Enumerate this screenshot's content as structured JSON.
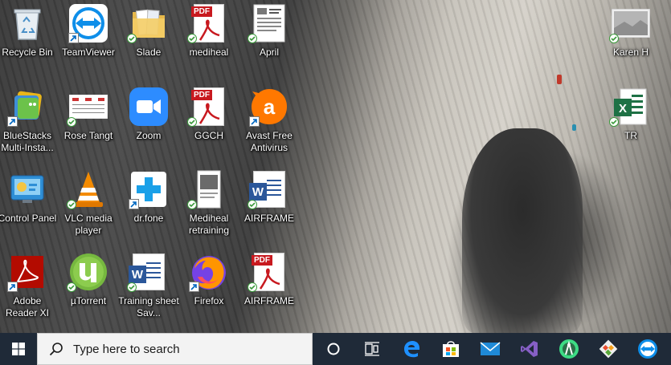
{
  "desktop": {
    "icons": [
      {
        "label": "Recycle Bin"
      },
      {
        "label": "TeamViewer"
      },
      {
        "label": "Slade"
      },
      {
        "label": "mediheal",
        "badge": "PDF"
      },
      {
        "label": "April"
      },
      {
        "label": "BlueStacks Multi-Insta..."
      },
      {
        "label": "Rose Tangt"
      },
      {
        "label": "Zoom"
      },
      {
        "label": "GGCH",
        "badge": "PDF"
      },
      {
        "label": "Avast Free Antivirus"
      },
      {
        "label": "Control Panel"
      },
      {
        "label": "VLC media player"
      },
      {
        "label": "dr.fone"
      },
      {
        "label": "Mediheal retraining"
      },
      {
        "label": "AIRFRAME",
        "badge": "W"
      },
      {
        "label": "Adobe Reader XI"
      },
      {
        "label": "µTorrent"
      },
      {
        "label": "Training sheet Sav...",
        "badge": "W"
      },
      {
        "label": "Firefox"
      },
      {
        "label": "AIRFRAME",
        "badge": "PDF"
      },
      {
        "label": "Karen H"
      },
      {
        "label": "TR",
        "badge": "X"
      }
    ]
  },
  "taskbar": {
    "search_placeholder": "Type here to search",
    "pinned_apps": [
      "cortana-icon",
      "task-view-icon",
      "edge-icon",
      "store-icon",
      "mail-icon",
      "visual-studio-icon",
      "android-studio-icon",
      "git-icon",
      "teamviewer-icon"
    ]
  },
  "colors": {
    "taskbar_bg": "#1f2a38",
    "pdf_red": "#c8191f",
    "word_blue": "#2b579a",
    "excel_green": "#1e7145",
    "sync_check": "#3a9a3a"
  }
}
